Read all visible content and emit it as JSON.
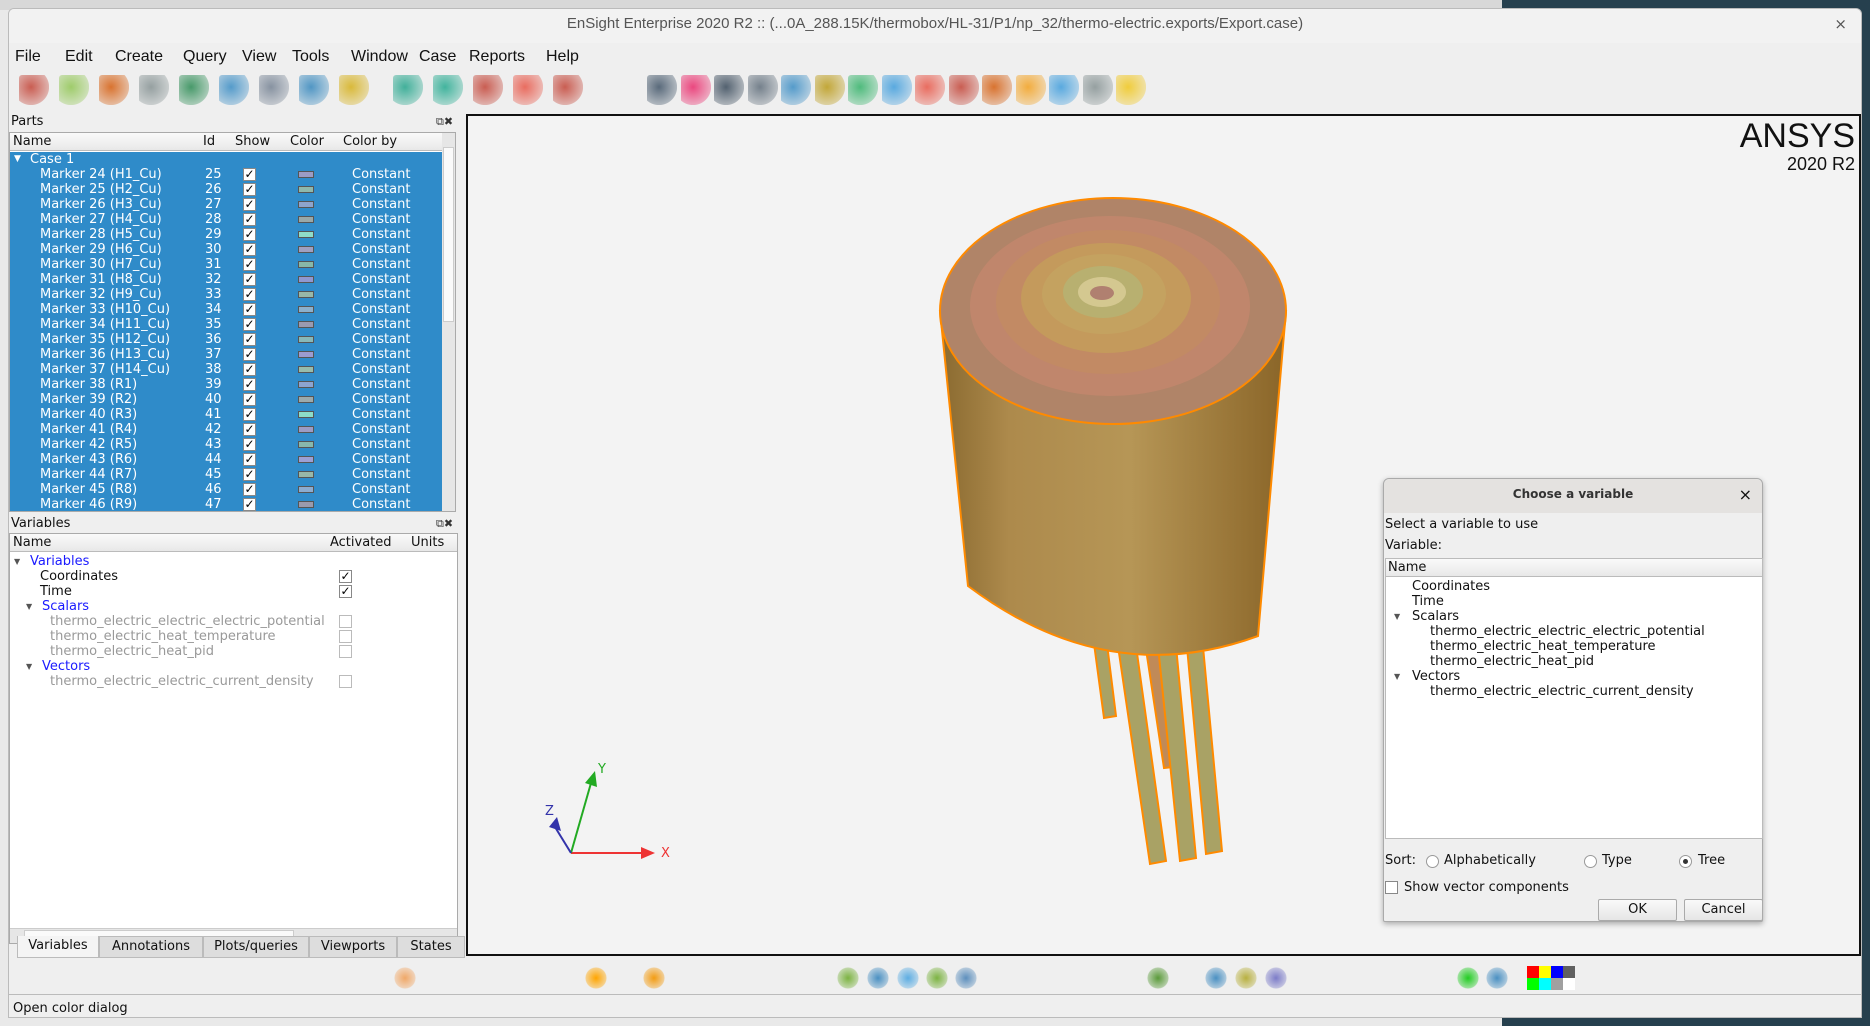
{
  "window": {
    "title": "EnSight Enterprise 2020 R2 :: (...0A_288.15K/thermobox/HL-31/P1/np_32/thermo-electric.exports/Export.case)",
    "close": "×"
  },
  "menu": [
    "File",
    "Edit",
    "Create",
    "Query",
    "View",
    "Tools",
    "Window",
    "Case",
    "Reports",
    "Help"
  ],
  "toolbar_icons": [
    "parts-icon",
    "calculator-icon",
    "plot-icon",
    "query-icon",
    "table-icon",
    "annotation-icon",
    "book-icon",
    "clapper-icon",
    "toolbox-icon",
    "contour-icon",
    "isosurface-icon",
    "clip-icon",
    "vector-arrows-icon",
    "particle-trace-icon",
    "elevated-surface-icon",
    "visibility-eye-icon",
    "color-wheel-icon",
    "line-width-icon",
    "fringe-icon",
    "volume-cube-icon",
    "hidden-line-icon",
    "triangle-icon",
    "node-icon",
    "element-icon",
    "subset-icon",
    "pencil-icon",
    "light-icon",
    "box-icon",
    "shading-icon",
    "lightning-icon"
  ],
  "parts": {
    "title": "Parts",
    "columns": [
      "Name",
      "Id",
      "Show",
      "Color",
      "Color by"
    ],
    "case": "Case 1",
    "rows": [
      {
        "name": "Marker 24 (H1_Cu)",
        "id": "25",
        "color": "#9c9cc4",
        "by": "Constant"
      },
      {
        "name": "Marker 25 (H2_Cu)",
        "id": "26",
        "color": "#8fb8ac",
        "by": "Constant"
      },
      {
        "name": "Marker 26 (H3_Cu)",
        "id": "27",
        "color": "#8ea4cc",
        "by": "Constant"
      },
      {
        "name": "Marker 27 (H4_Cu)",
        "id": "28",
        "color": "#9aa8a8",
        "by": "Constant"
      },
      {
        "name": "Marker 28 (H5_Cu)",
        "id": "29",
        "color": "#8fdcc8",
        "by": "Constant"
      },
      {
        "name": "Marker 29 (H6_Cu)",
        "id": "30",
        "color": "#a0a0c0",
        "by": "Constant"
      },
      {
        "name": "Marker 30 (H7_Cu)",
        "id": "31",
        "color": "#88b8a8",
        "by": "Constant"
      },
      {
        "name": "Marker 31 (H8_Cu)",
        "id": "32",
        "color": "#9098d0",
        "by": "Constant"
      },
      {
        "name": "Marker 32 (H9_Cu)",
        "id": "33",
        "color": "#98b8a8",
        "by": "Constant"
      },
      {
        "name": "Marker 33 (H10_Cu)",
        "id": "34",
        "color": "#8cb0cc",
        "by": "Constant"
      },
      {
        "name": "Marker 34 (H11_Cu)",
        "id": "35",
        "color": "#9a9ab0",
        "by": "Constant"
      },
      {
        "name": "Marker 35 (H12_Cu)",
        "id": "36",
        "color": "#88b8b8",
        "by": "Constant"
      },
      {
        "name": "Marker 36 (H13_Cu)",
        "id": "37",
        "color": "#9c9cd0",
        "by": "Constant"
      },
      {
        "name": "Marker 37 (H14_Cu)",
        "id": "38",
        "color": "#98bcac",
        "by": "Constant"
      },
      {
        "name": "Marker 38 (R1)",
        "id": "39",
        "color": "#8ca4d0",
        "by": "Constant"
      },
      {
        "name": "Marker 39 (R2)",
        "id": "40",
        "color": "#9caaac",
        "by": "Constant"
      },
      {
        "name": "Marker 40 (R3)",
        "id": "41",
        "color": "#8cdcc8",
        "by": "Constant"
      },
      {
        "name": "Marker 41 (R4)",
        "id": "42",
        "color": "#9c9cc4",
        "by": "Constant"
      },
      {
        "name": "Marker 42 (R5)",
        "id": "43",
        "color": "#88b8ac",
        "by": "Constant"
      },
      {
        "name": "Marker 43 (R6)",
        "id": "44",
        "color": "#9ca0d4",
        "by": "Constant"
      },
      {
        "name": "Marker 44 (R7)",
        "id": "45",
        "color": "#98b8a8",
        "by": "Constant"
      },
      {
        "name": "Marker 45 (R8)",
        "id": "46",
        "color": "#8cacd0",
        "by": "Constant"
      },
      {
        "name": "Marker 46 (R9)",
        "id": "47",
        "color": "#9a9aac",
        "by": "Constant"
      }
    ]
  },
  "variables": {
    "title": "Variables",
    "columns": [
      "Name",
      "Activated",
      "Units"
    ],
    "tree": [
      {
        "label": "Variables",
        "kind": "group",
        "level": 0
      },
      {
        "label": "Coordinates",
        "kind": "item",
        "level": 1,
        "active": true
      },
      {
        "label": "Time",
        "kind": "item",
        "level": 1,
        "active": true
      },
      {
        "label": "Scalars",
        "kind": "group",
        "level": 1
      },
      {
        "label": "thermo_electric_electric_electric_potential",
        "kind": "inactive",
        "level": 2,
        "active": false
      },
      {
        "label": "thermo_electric_heat_temperature",
        "kind": "inactive",
        "level": 2,
        "active": false
      },
      {
        "label": "thermo_electric_heat_pid",
        "kind": "inactive",
        "level": 2,
        "active": false
      },
      {
        "label": "Vectors",
        "kind": "group",
        "level": 1
      },
      {
        "label": "thermo_electric_electric_current_density",
        "kind": "inactive",
        "level": 2,
        "active": false
      }
    ]
  },
  "tabs": [
    "Variables",
    "Annotations",
    "Plots/queries",
    "Viewports",
    "States"
  ],
  "status": "Open color dialog",
  "logo": {
    "name": "ANSYS",
    "version": "2020 R2"
  },
  "axes": {
    "x": "X",
    "y": "Y",
    "z": "Z"
  },
  "dialog": {
    "title": "Choose a variable",
    "prompt": "Select a variable to use",
    "variable_label": "Variable:",
    "column": "Name",
    "tree": [
      {
        "label": "Coordinates",
        "level": 1
      },
      {
        "label": "Time",
        "level": 1
      },
      {
        "label": "Scalars",
        "level": 1,
        "group": true
      },
      {
        "label": "thermo_electric_electric_electric_potential",
        "level": 2
      },
      {
        "label": "thermo_electric_heat_temperature",
        "level": 2
      },
      {
        "label": "thermo_electric_heat_pid",
        "level": 2
      },
      {
        "label": "Vectors",
        "level": 1,
        "group": true
      },
      {
        "label": "thermo_electric_electric_current_density",
        "level": 2
      }
    ],
    "sort_label": "Sort:",
    "sort_options": [
      "Alphabetically",
      "Type",
      "Tree"
    ],
    "sort_selected": "Tree",
    "show_vector_components": "Show vector components",
    "ok": "OK",
    "cancel": "Cancel",
    "close": "×"
  },
  "palette": [
    "#ff0000",
    "#ffff00",
    "#0000ff",
    "#606060",
    "#00ff00",
    "#00ffff",
    "#a0a0a0",
    "#ffffff"
  ]
}
